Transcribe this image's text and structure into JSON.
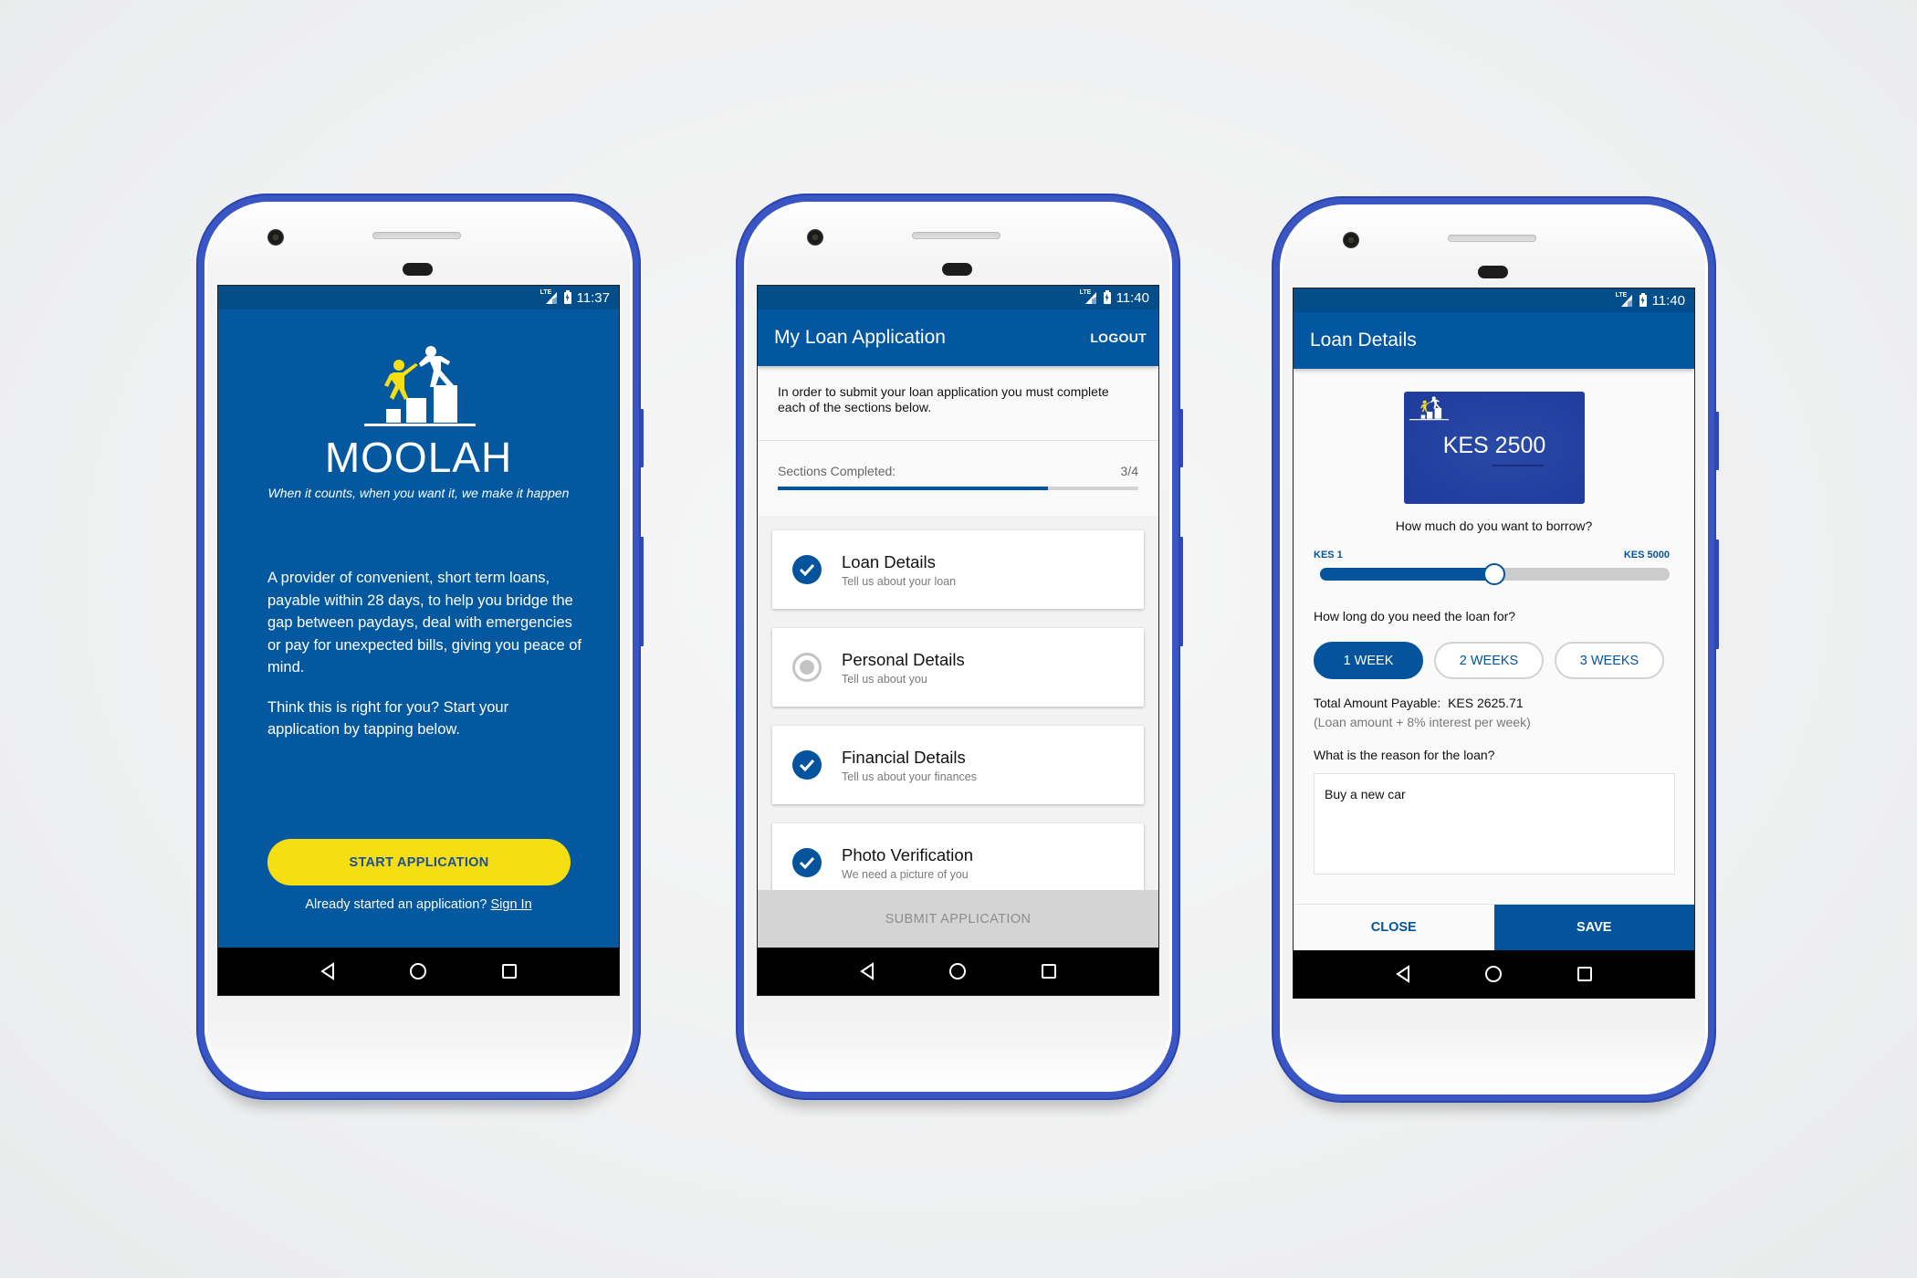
{
  "colors": {
    "primary": "#0357a1",
    "status_bar": "#024e8b",
    "accent_yellow": "#f5de12",
    "phone_frame": "#3a55c4",
    "disabled_gray": "#d4d4d4"
  },
  "phones": [
    {
      "status": {
        "network": "LTE",
        "time": "11:37"
      },
      "welcome": {
        "logo_icon": "helping-hand-steps-icon",
        "brand": "MOOLAH",
        "tagline": "When it counts, when you want it, we make it happen",
        "paragraph_1": "A provider of convenient, short term loans, payable within 28 days, to help you bridge the gap between paydays, deal with emergencies or pay for unexpected bills, giving you peace of mind.",
        "paragraph_2": "Think this is right for you? Start your application by tapping below.",
        "start_button": "START APPLICATION",
        "signin_prompt": "Already started an application?",
        "signin_link": "Sign In"
      },
      "navbar": [
        "back-icon",
        "home-icon",
        "recents-icon"
      ]
    },
    {
      "status": {
        "network": "LTE",
        "time": "11:40"
      },
      "appbar": {
        "title": "My Loan Application",
        "action": "LOGOUT"
      },
      "intro": "In order to submit your loan application you must complete each of the sections below.",
      "progress": {
        "label": "Sections Completed:",
        "completed": 3,
        "total": 4,
        "display": "3/4",
        "fraction": 0.75
      },
      "sections": [
        {
          "title": "Loan Details",
          "subtitle": "Tell us about your loan",
          "status": "complete"
        },
        {
          "title": "Personal Details",
          "subtitle": "Tell us about you",
          "status": "incomplete"
        },
        {
          "title": "Financial Details",
          "subtitle": "Tell us about your finances",
          "status": "complete"
        },
        {
          "title": "Photo Verification",
          "subtitle": "We need a picture of you",
          "status": "complete"
        }
      ],
      "submit_button": "SUBMIT APPLICATION",
      "navbar": [
        "back-icon",
        "home-icon",
        "recents-icon"
      ]
    },
    {
      "status": {
        "network": "LTE",
        "time": "11:40"
      },
      "appbar": {
        "title": "Loan Details"
      },
      "amount_display": "KES 2500",
      "borrow_question": "How much do you want to borrow?",
      "slider": {
        "min_label": "KES 1",
        "max_label": "KES 5000",
        "min": 1,
        "max": 5000,
        "value": 2500
      },
      "duration_question": "How long do you need the loan for?",
      "durations": [
        {
          "label": "1 WEEK",
          "selected": true
        },
        {
          "label": "2 WEEKS",
          "selected": false
        },
        {
          "label": "3 WEEKS",
          "selected": false
        }
      ],
      "total_label": "Total Amount Payable:",
      "total_value": "KES 2625.71",
      "total_note": "(Loan amount + 8% interest per week)",
      "reason_question": "What is the reason for the loan?",
      "reason_value": "Buy a new car",
      "close_button": "CLOSE",
      "save_button": "SAVE",
      "navbar": [
        "back-icon",
        "home-icon",
        "recents-icon"
      ]
    }
  ]
}
